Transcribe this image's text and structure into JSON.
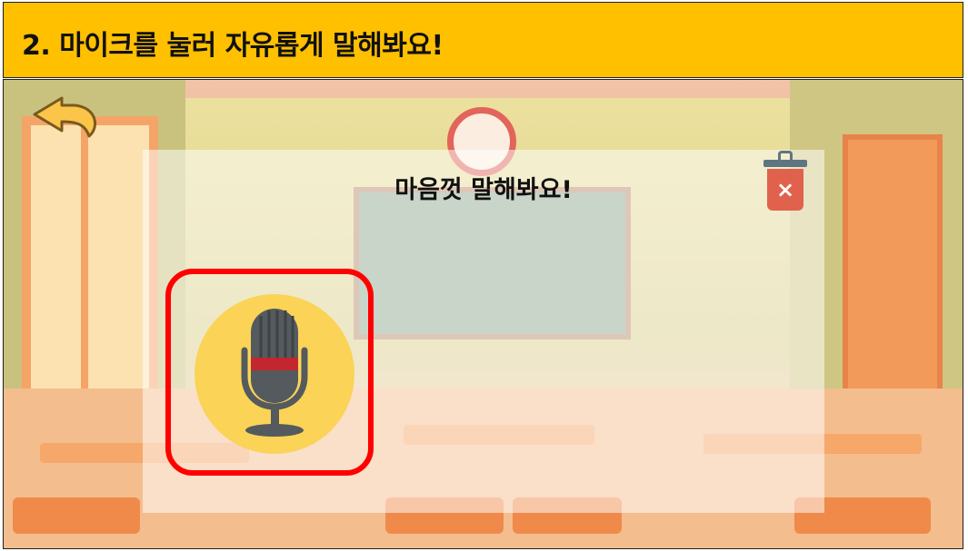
{
  "header": {
    "title": "2. 마이크를 눌러 자유롭게 말해봐요!"
  },
  "panel": {
    "heading": "마음껏 말해봐요!"
  },
  "trash": {
    "glyph": "×"
  },
  "icons": {
    "back": "back-arrow-icon",
    "trash": "trash-icon",
    "mic": "microphone-icon"
  },
  "colors": {
    "header_bg": "#FFC000",
    "mic_highlight": "#FF0000",
    "mic_bg": "#FBD356",
    "trash_can": "#E0624D"
  }
}
